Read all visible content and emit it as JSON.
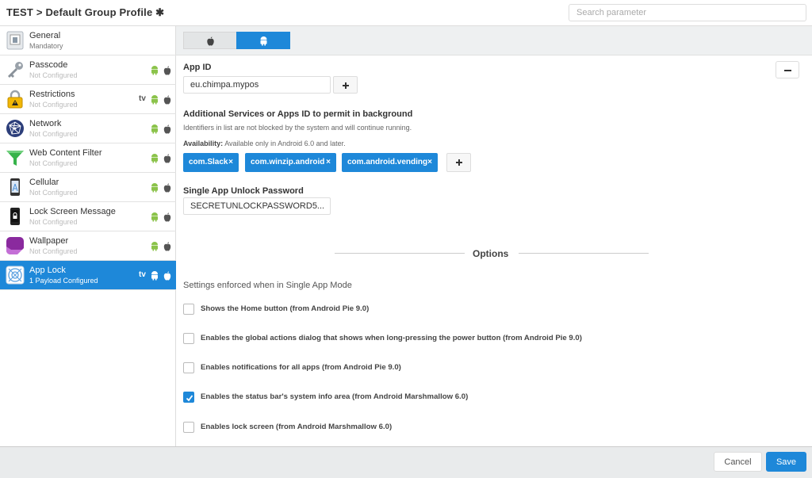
{
  "header": {
    "title": "TEST > Default Group Profile ✱",
    "search_placeholder": "Search parameter"
  },
  "sidebar": {
    "items": [
      {
        "label": "General",
        "sub": "Mandatory",
        "icon": "general-icon",
        "platforms": []
      },
      {
        "label": "Passcode",
        "sub": "Not Configured",
        "icon": "key-icon",
        "platforms": [
          "android",
          "apple"
        ]
      },
      {
        "label": "Restrictions",
        "sub": "Not Configured",
        "icon": "lock-icon",
        "platforms": [
          "tv",
          "android",
          "apple"
        ]
      },
      {
        "label": "Network",
        "sub": "Not Configured",
        "icon": "network-icon",
        "platforms": [
          "android",
          "apple"
        ]
      },
      {
        "label": "Web Content Filter",
        "sub": "Not Configured",
        "icon": "funnel-icon",
        "platforms": [
          "android",
          "apple"
        ]
      },
      {
        "label": "Cellular",
        "sub": "Not Configured",
        "icon": "cellular-icon",
        "platforms": [
          "android",
          "apple"
        ]
      },
      {
        "label": "Lock Screen Message",
        "sub": "Not Configured",
        "icon": "lock-screen-icon",
        "platforms": [
          "android",
          "apple"
        ]
      },
      {
        "label": "Wallpaper",
        "sub": "Not Configured",
        "icon": "wallpaper-icon",
        "platforms": [
          "android",
          "apple"
        ]
      },
      {
        "label": "App Lock",
        "sub": "1 Payload Configured",
        "icon": "app-lock-icon",
        "platforms": [
          "tv",
          "android",
          "apple"
        ]
      }
    ],
    "tv_label": "tv"
  },
  "tabs": {
    "apple_icon": "apple-icon",
    "android_icon": "android-icon",
    "active": "android"
  },
  "form": {
    "app_id_label": "App ID",
    "app_id_value": "eu.chimpa.mypos",
    "additional_label": "Additional Services or Apps ID to permit in background",
    "additional_helper": "Identifiers in list are not blocked by the system and will continue running.",
    "availability_label": "Availability:",
    "availability_text": " Available only in Android 6.0 and later.",
    "tags": [
      "com.Slack",
      "com.winzip.android",
      "com.android.vending"
    ],
    "tag_remove": "×",
    "password_label": "Single App Unlock Password",
    "password_value": "SECRETUNLOCKPASSWORD5..."
  },
  "options": {
    "title": "Options",
    "caption": "Settings enforced when in Single App Mode",
    "items": [
      {
        "label": "Shows the Home button (from Android Pie 9.0)",
        "checked": false
      },
      {
        "label": "Enables the global actions dialog that shows when long-pressing the power button (from Android Pie 9.0)",
        "checked": false
      },
      {
        "label": "Enables notifications for all apps (from Android Pie 9.0)",
        "checked": false
      },
      {
        "label": "Enables the status bar's system info area (from Android Marshmallow 6.0)",
        "checked": true
      },
      {
        "label": "Enables lock screen (from Android Marshmallow 6.0)",
        "checked": false
      }
    ]
  },
  "footer": {
    "cancel": "Cancel",
    "save": "Save"
  },
  "colors": {
    "accent": "#1e88d9",
    "android": "#8bc34a"
  }
}
